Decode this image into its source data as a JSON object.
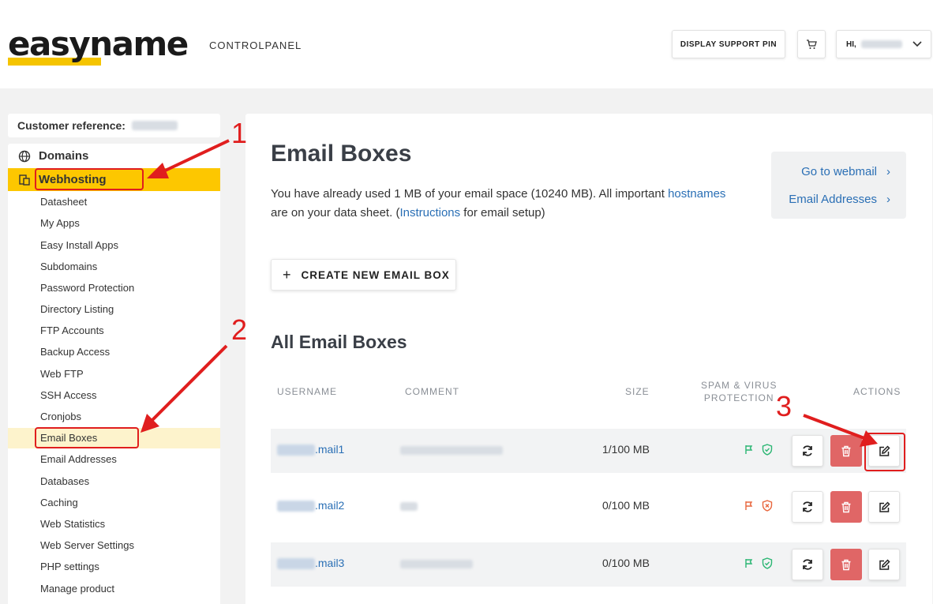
{
  "header": {
    "logo": "easyname",
    "controlpanel_label": "CONTROLPANEL",
    "support_pin_label": "DISPLAY SUPPORT PIN",
    "user_greeting": "HI,"
  },
  "sidebar": {
    "customer_reference_label": "Customer reference:",
    "domains_label": "Domains",
    "webhosting_label": "Webhosting",
    "items": [
      {
        "label": "Datasheet"
      },
      {
        "label": "My Apps"
      },
      {
        "label": "Easy Install Apps"
      },
      {
        "label": "Subdomains"
      },
      {
        "label": "Password Protection"
      },
      {
        "label": "Directory Listing"
      },
      {
        "label": "FTP Accounts"
      },
      {
        "label": "Backup Access"
      },
      {
        "label": "Web FTP"
      },
      {
        "label": "SSH Access"
      },
      {
        "label": "Cronjobs"
      },
      {
        "label": "Email Boxes"
      },
      {
        "label": "Email Addresses"
      },
      {
        "label": "Databases"
      },
      {
        "label": "Caching"
      },
      {
        "label": "Web Statistics"
      },
      {
        "label": "Web Server Settings"
      },
      {
        "label": "PHP settings"
      },
      {
        "label": "Manage product"
      }
    ]
  },
  "main": {
    "title": "Email Boxes",
    "intro_1": "You have already used 1 MB of your email space (10240 MB). All important",
    "intro_link_hostnames": "hostnames",
    "intro_2": " are on your data sheet. (",
    "intro_link_instructions": "Instructions",
    "intro_3": " for email setup)",
    "webmail_link": "Go to webmail",
    "addresses_link": "Email Addresses",
    "create_button": "CREATE NEW EMAIL BOX",
    "section_title": "All Email Boxes",
    "columns": {
      "username": "USERNAME",
      "comment": "COMMENT",
      "size": "SIZE",
      "spam_1": "SPAM & VIRUS",
      "spam_2": "PROTECTION",
      "actions": "ACTIONS"
    },
    "rows": [
      {
        "username_suffix": ".mail1",
        "size": "1/100 MB",
        "protection_color": "#2bb673"
      },
      {
        "username_suffix": ".mail2",
        "size": "0/100 MB",
        "protection_color": "#e8663d"
      },
      {
        "username_suffix": ".mail3",
        "size": "0/100 MB",
        "protection_color": "#2bb673"
      }
    ]
  },
  "annotations": {
    "step1": "1",
    "step2": "2",
    "step3": "3",
    "color": "#e01e1e"
  },
  "colors": {
    "brand_yellow": "#fdc700",
    "link_blue": "#2a6fb5",
    "delete_red": "#e06666"
  }
}
